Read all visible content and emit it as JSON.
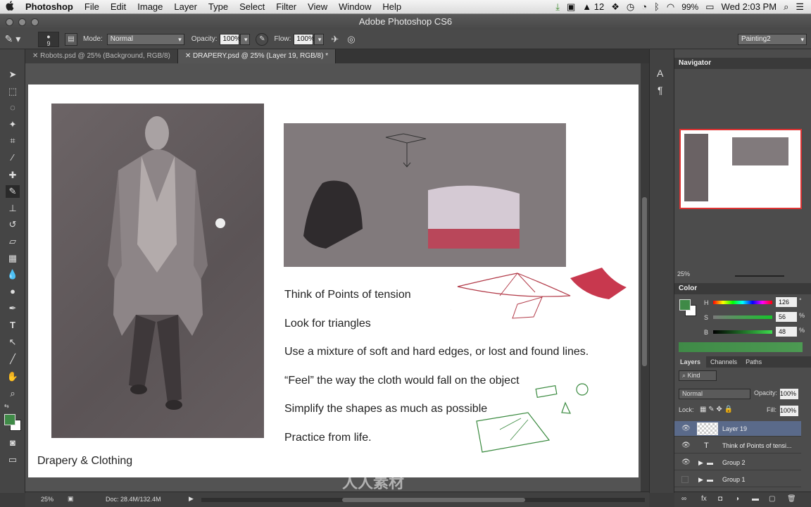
{
  "menubar": {
    "apple": "",
    "app": "Photoshop",
    "items": [
      "File",
      "Edit",
      "Image",
      "Layer",
      "Type",
      "Select",
      "Filter",
      "View",
      "Window",
      "Help"
    ],
    "adobe_updates": "12",
    "battery": "99%",
    "clock": "Wed 2:03 PM"
  },
  "window": {
    "title": "Adobe Photoshop CS6"
  },
  "options": {
    "brush_size": "9",
    "mode_label": "Mode:",
    "mode_value": "Normal",
    "opacity_label": "Opacity:",
    "opacity_value": "100%",
    "flow_label": "Flow:",
    "flow_value": "100%",
    "workspace": "Painting2"
  },
  "tabs": [
    {
      "label": "Robots.psd @ 25% (Background, RGB/8)"
    },
    {
      "label": "DRAPERY.psd @ 25% (Layer 19, RGB/8) *"
    }
  ],
  "document": {
    "lines": [
      "Think of Points of tension",
      "Look for triangles",
      "Use a mixture of soft and hard edges, or lost and found lines.",
      "“Feel” the way the cloth would fall on the object",
      "Simplify the shapes as much as possible",
      "Practice from life."
    ],
    "caption": "Drapery & Clothing"
  },
  "navigator": {
    "title": "Navigator",
    "zoom": "25%"
  },
  "color": {
    "title": "Color",
    "h_label": "H",
    "h_value": "126",
    "h_unit": "°",
    "s_label": "S",
    "s_value": "56",
    "s_unit": "%",
    "b_label": "B",
    "b_value": "48",
    "b_unit": "%",
    "fg": "#3f8a47"
  },
  "layers_panel": {
    "tabs": [
      "Layers",
      "Channels",
      "Paths"
    ],
    "kind": "Kind",
    "blend": "Normal",
    "opacity_label": "Opacity:",
    "opacity_value": "100%",
    "lock_label": "Lock:",
    "fill_label": "Fill:",
    "fill_value": "100%",
    "layers": [
      {
        "name": "Layer 19"
      },
      {
        "name": "Think of Points of tensi..."
      },
      {
        "name": "Group 2"
      },
      {
        "name": "Group 1"
      }
    ]
  },
  "status": {
    "zoom": "25%",
    "doc": "Doc: 28.4M/132.4M"
  },
  "watermark": "人人素材"
}
